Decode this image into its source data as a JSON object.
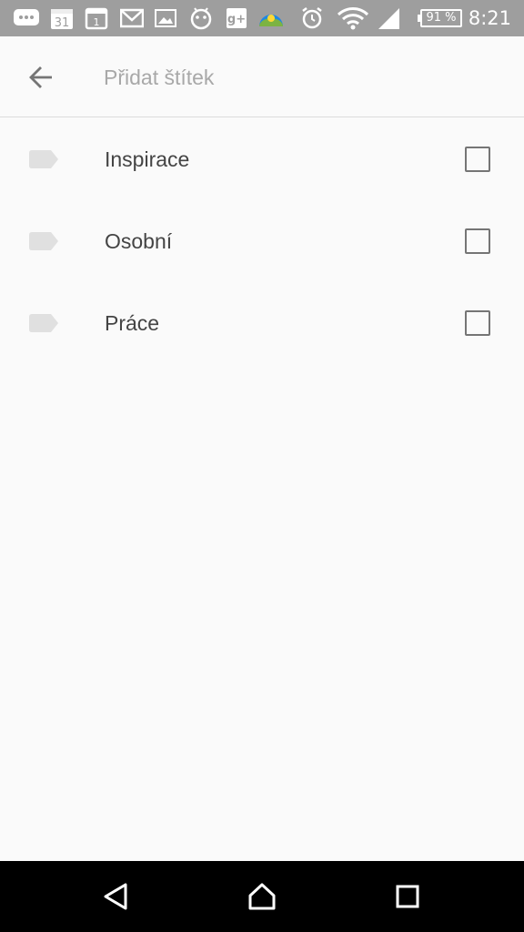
{
  "status_bar": {
    "notification_icons": [
      "chat-bubble-icon",
      "calendar-31-icon",
      "calendar-1-icon",
      "gmail-icon",
      "image-icon",
      "android-icon",
      "google-plus-icon",
      "weather-icon"
    ],
    "calendar_day_a": "31",
    "calendar_day_b": "1",
    "google_plus_label": "g+",
    "battery": "91 %",
    "time": "8:21"
  },
  "toolbar": {
    "search_placeholder": "Přidat štítek"
  },
  "labels": [
    {
      "name": "Inspirace",
      "checked": false
    },
    {
      "name": "Osobní",
      "checked": false
    },
    {
      "name": "Práce",
      "checked": false
    }
  ],
  "nav_bar": {
    "buttons": [
      "back-icon",
      "home-icon",
      "recents-icon"
    ]
  },
  "colors": {
    "status_bar": "#9e9e9e",
    "background": "#fafafa",
    "tag": "#e0e0e0",
    "checkbox_border": "#757575",
    "nav_bar": "#000000"
  }
}
